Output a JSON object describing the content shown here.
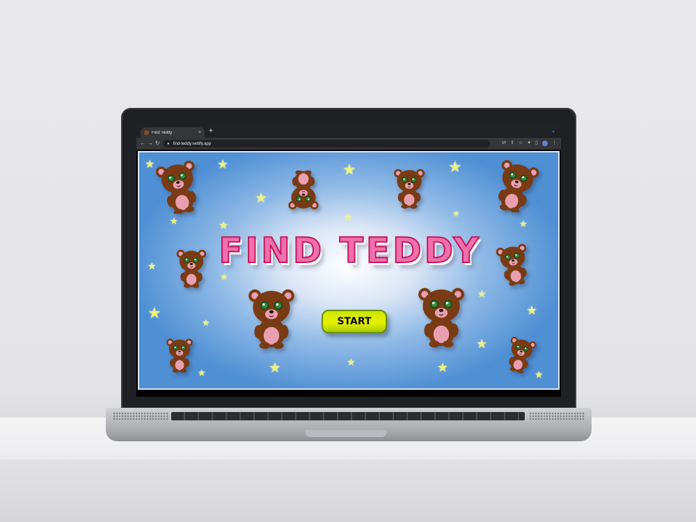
{
  "browser": {
    "tab_title": "Find Teddy",
    "tab_close": "×",
    "new_tab": "+",
    "tabs_menu": "⌄",
    "back": "←",
    "forward": "→",
    "reload": "↻",
    "lock": "🔒",
    "url": "find-teddy.netlify.app",
    "avatar_initial": "",
    "tool_icons": [
      "translate-icon",
      "share-icon",
      "star-icon",
      "extensions-icon",
      "sidebar-icon",
      "profile-icon",
      "menu-icon"
    ]
  },
  "game": {
    "title": "FIND TEDDY",
    "start_label": "START"
  },
  "colors": {
    "title_fill": "#f06fae",
    "title_stroke": "#c2185b",
    "background_edge": "#4f8fd4",
    "button_fill": "#e8f000",
    "bear_fur": "#7a3b14",
    "bear_muzzle": "#e8a0b0",
    "bear_eyes": "#3a8a3a",
    "star": "#eef27d"
  }
}
